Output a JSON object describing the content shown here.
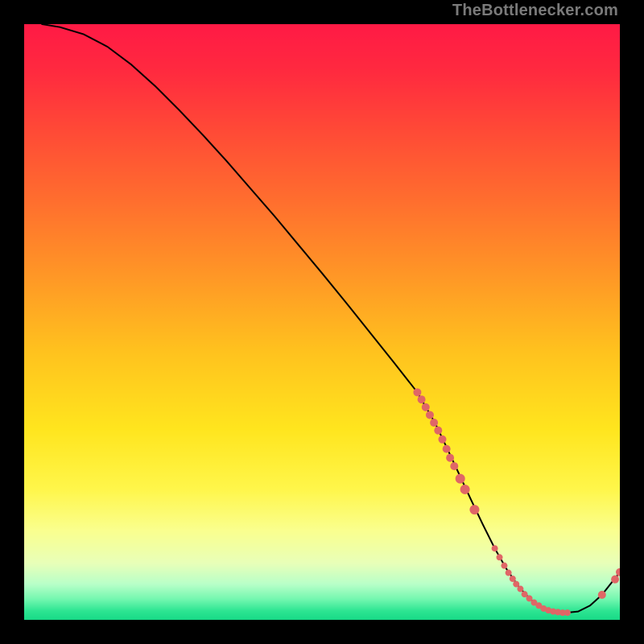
{
  "attribution": "TheBottlenecker.com",
  "palette": {
    "curve": "#000000",
    "marker": "#e06666",
    "gradient_stops": [
      {
        "offset": 0.0,
        "color": "#ff1a45"
      },
      {
        "offset": 0.08,
        "color": "#ff2a3f"
      },
      {
        "offset": 0.18,
        "color": "#ff4a36"
      },
      {
        "offset": 0.3,
        "color": "#ff6f2e"
      },
      {
        "offset": 0.42,
        "color": "#ff9626"
      },
      {
        "offset": 0.55,
        "color": "#ffc21e"
      },
      {
        "offset": 0.68,
        "color": "#ffe51e"
      },
      {
        "offset": 0.78,
        "color": "#fff64a"
      },
      {
        "offset": 0.85,
        "color": "#faff8e"
      },
      {
        "offset": 0.905,
        "color": "#e8ffb8"
      },
      {
        "offset": 0.94,
        "color": "#b8ffc8"
      },
      {
        "offset": 0.965,
        "color": "#74f7b0"
      },
      {
        "offset": 0.985,
        "color": "#2de592"
      },
      {
        "offset": 1.0,
        "color": "#18d987"
      }
    ]
  },
  "chart_data": {
    "type": "line",
    "title": "",
    "xlabel": "",
    "ylabel": "",
    "xlim": [
      0,
      100
    ],
    "ylim": [
      0,
      100
    ],
    "grid": false,
    "legend": false,
    "series": [
      {
        "name": "bottleneck-curve",
        "x": [
          3,
          6,
          10,
          14,
          18,
          22,
          26,
          30,
          34,
          38,
          42,
          46,
          50,
          54,
          58,
          62,
          66,
          69,
          71,
          73,
          75,
          77,
          79,
          81,
          83,
          85,
          87,
          89,
          91,
          93,
          95,
          97,
          100
        ],
        "y": [
          100,
          99.5,
          98.3,
          96.2,
          93.2,
          89.6,
          85.6,
          81.4,
          77.0,
          72.4,
          67.8,
          63.0,
          58.2,
          53.3,
          48.3,
          43.3,
          38.2,
          33.0,
          28.8,
          24.5,
          20.2,
          16.0,
          12.0,
          8.5,
          5.6,
          3.4,
          2.0,
          1.4,
          1.2,
          1.4,
          2.4,
          4.2,
          8.0
        ]
      }
    ],
    "markers": {
      "name": "data-points",
      "color_ref": "marker",
      "points": [
        {
          "x": 66.0,
          "y": 38.2,
          "r": 5
        },
        {
          "x": 66.7,
          "y": 37.0,
          "r": 5
        },
        {
          "x": 67.4,
          "y": 35.7,
          "r": 5
        },
        {
          "x": 68.1,
          "y": 34.4,
          "r": 5
        },
        {
          "x": 68.8,
          "y": 33.1,
          "r": 5
        },
        {
          "x": 69.5,
          "y": 31.8,
          "r": 5
        },
        {
          "x": 70.2,
          "y": 30.3,
          "r": 5
        },
        {
          "x": 70.9,
          "y": 28.7,
          "r": 5
        },
        {
          "x": 71.5,
          "y": 27.2,
          "r": 5
        },
        {
          "x": 72.2,
          "y": 25.8,
          "r": 5
        },
        {
          "x": 73.2,
          "y": 23.7,
          "r": 6
        },
        {
          "x": 74.0,
          "y": 21.9,
          "r": 6
        },
        {
          "x": 75.6,
          "y": 18.5,
          "r": 6
        },
        {
          "x": 79.0,
          "y": 12.0,
          "r": 4
        },
        {
          "x": 79.8,
          "y": 10.5,
          "r": 4
        },
        {
          "x": 80.6,
          "y": 9.1,
          "r": 4
        },
        {
          "x": 81.3,
          "y": 7.9,
          "r": 4
        },
        {
          "x": 82.0,
          "y": 6.9,
          "r": 4
        },
        {
          "x": 82.6,
          "y": 6.0,
          "r": 4
        },
        {
          "x": 83.3,
          "y": 5.2,
          "r": 4
        },
        {
          "x": 84.0,
          "y": 4.3,
          "r": 4
        },
        {
          "x": 84.8,
          "y": 3.6,
          "r": 4
        },
        {
          "x": 85.6,
          "y": 2.9,
          "r": 4
        },
        {
          "x": 86.4,
          "y": 2.4,
          "r": 4
        },
        {
          "x": 87.2,
          "y": 1.9,
          "r": 4
        },
        {
          "x": 88.0,
          "y": 1.6,
          "r": 4
        },
        {
          "x": 88.8,
          "y": 1.4,
          "r": 4
        },
        {
          "x": 89.6,
          "y": 1.3,
          "r": 4
        },
        {
          "x": 90.4,
          "y": 1.2,
          "r": 4
        },
        {
          "x": 91.2,
          "y": 1.2,
          "r": 4
        },
        {
          "x": 97.0,
          "y": 4.2,
          "r": 5
        },
        {
          "x": 99.2,
          "y": 6.8,
          "r": 5
        },
        {
          "x": 100.0,
          "y": 8.0,
          "r": 5
        }
      ]
    }
  }
}
